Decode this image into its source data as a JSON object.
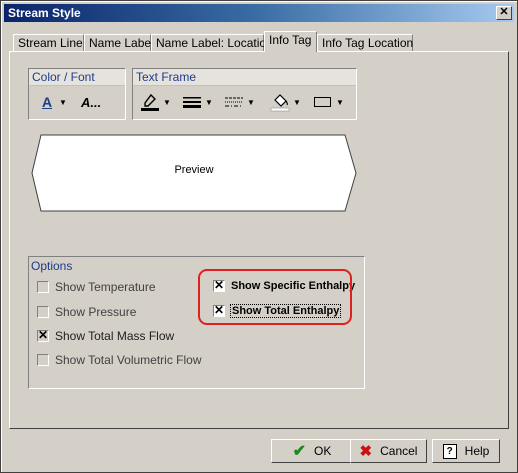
{
  "window": {
    "title": "Stream Style",
    "close_glyph": "✕"
  },
  "tabs": [
    {
      "label": "Stream Line",
      "active": false
    },
    {
      "label": "Name Label",
      "active": false
    },
    {
      "label": "Name Label: Location",
      "active": false
    },
    {
      "label": "Info Tag",
      "active": true
    },
    {
      "label": "Info Tag Location",
      "active": false
    }
  ],
  "color_font": {
    "header": "Color / Font",
    "tools": [
      {
        "icon": "font-color-icon",
        "glyph": "A"
      },
      {
        "icon": "font-style-icon",
        "glyph": "A..."
      }
    ]
  },
  "text_frame": {
    "header": "Text Frame",
    "tools": [
      {
        "icon": "line-color-pen-icon"
      },
      {
        "icon": "line-weight-icon"
      },
      {
        "icon": "line-style-icon"
      },
      {
        "icon": "fill-color-bucket-icon"
      },
      {
        "icon": "frame-shape-icon"
      }
    ]
  },
  "preview": {
    "label": "Preview"
  },
  "options": {
    "header": "Options",
    "items": [
      {
        "label": "Show Temperature",
        "checked": false
      },
      {
        "label": "Show Pressure",
        "checked": false
      },
      {
        "label": "Show Total Mass Flow",
        "checked": true
      },
      {
        "label": "Show Total Volumetric Flow",
        "checked": false
      },
      {
        "label": "Show Specific Enthalpy",
        "checked": true
      },
      {
        "label": "Show Total Enthalpy",
        "checked": true
      }
    ]
  },
  "buttons": {
    "ok": {
      "label": "OK",
      "icon": "checkmark-icon"
    },
    "cancel": {
      "label": "Cancel",
      "icon": "red-x-icon"
    },
    "help": {
      "label": "Help",
      "icon": "help-question-icon"
    }
  },
  "colors": {
    "highlight": "#e02020",
    "accent_text": "#1e3c8c",
    "title_bar": "#0a246a"
  }
}
